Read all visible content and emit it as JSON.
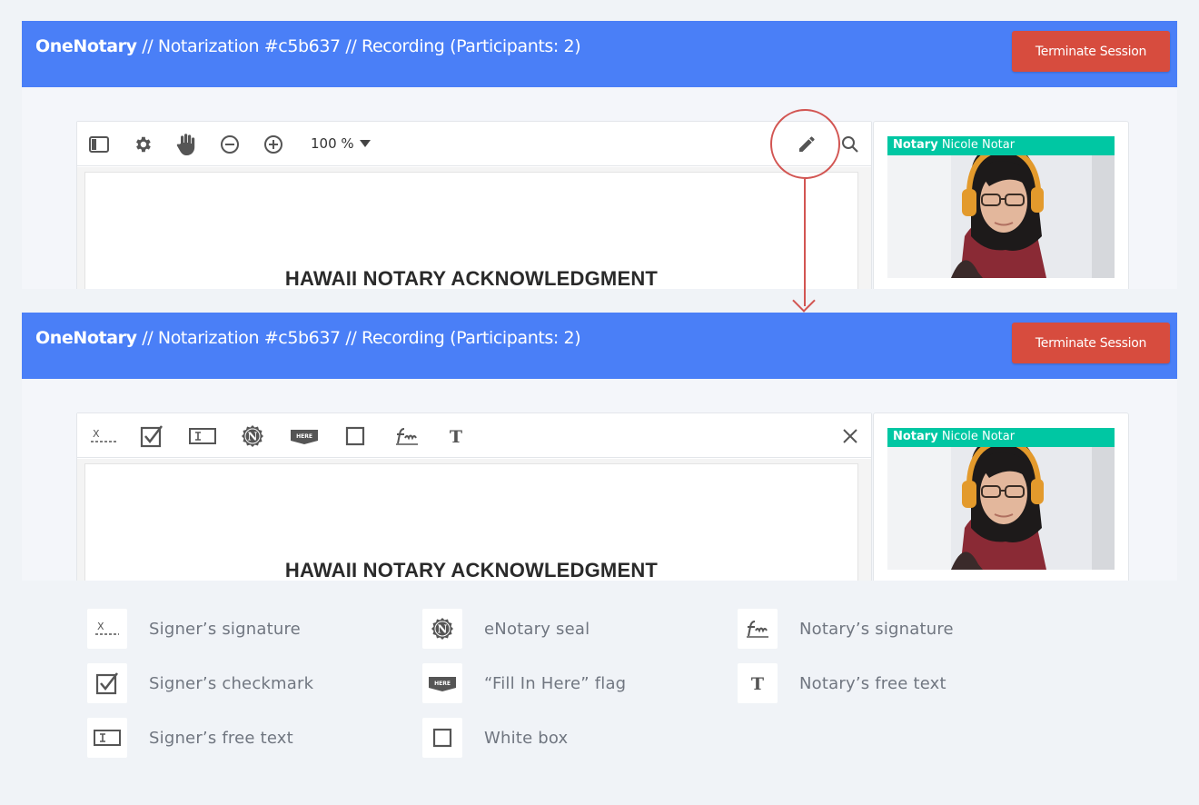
{
  "header": {
    "brand": "OneNotary",
    "rest": " // Notarization #c5b637 // Recording (Participants: 2)",
    "terminate_label": "Terminate Session"
  },
  "viewer_toolbar": {
    "icons": [
      "sidebar-icon",
      "gear-icon",
      "hand-icon",
      "zoom-out-icon",
      "zoom-in-icon",
      "pencil-icon",
      "search-icon"
    ],
    "zoom_label": "100 %"
  },
  "annotate_toolbar": {
    "icons": [
      "signer-signature-icon",
      "signer-checkmark-icon",
      "signer-free-text-icon",
      "enotary-seal-icon",
      "fill-in-here-flag-icon",
      "white-box-icon",
      "notary-signature-icon",
      "notary-free-text-icon",
      "close-icon"
    ],
    "signature_glyph": "X",
    "seal_glyph": "N",
    "flag_glyph": "HERE",
    "text_glyph": "T"
  },
  "document": {
    "title": "HAWAII NOTARY ACKNOWLEDGMENT"
  },
  "video": {
    "role": "Notary",
    "name": " Nicole Notar"
  },
  "legend": {
    "signer_signature": "Signer’s signature",
    "signer_checkmark": "Signer’s checkmark",
    "signer_free_text": "Signer’s free text",
    "enotary_seal": "eNotary seal",
    "fill_in_here": "“Fill In Here” flag",
    "white_box": "White box",
    "notary_signature": "Notary’s signature",
    "notary_free_text": "Notary’s free text"
  },
  "colors": {
    "header_blue": "#4a7ff7",
    "terminate_red": "#d74c3e",
    "video_label_green": "#00c7a3",
    "highlight_red": "#d25552"
  }
}
